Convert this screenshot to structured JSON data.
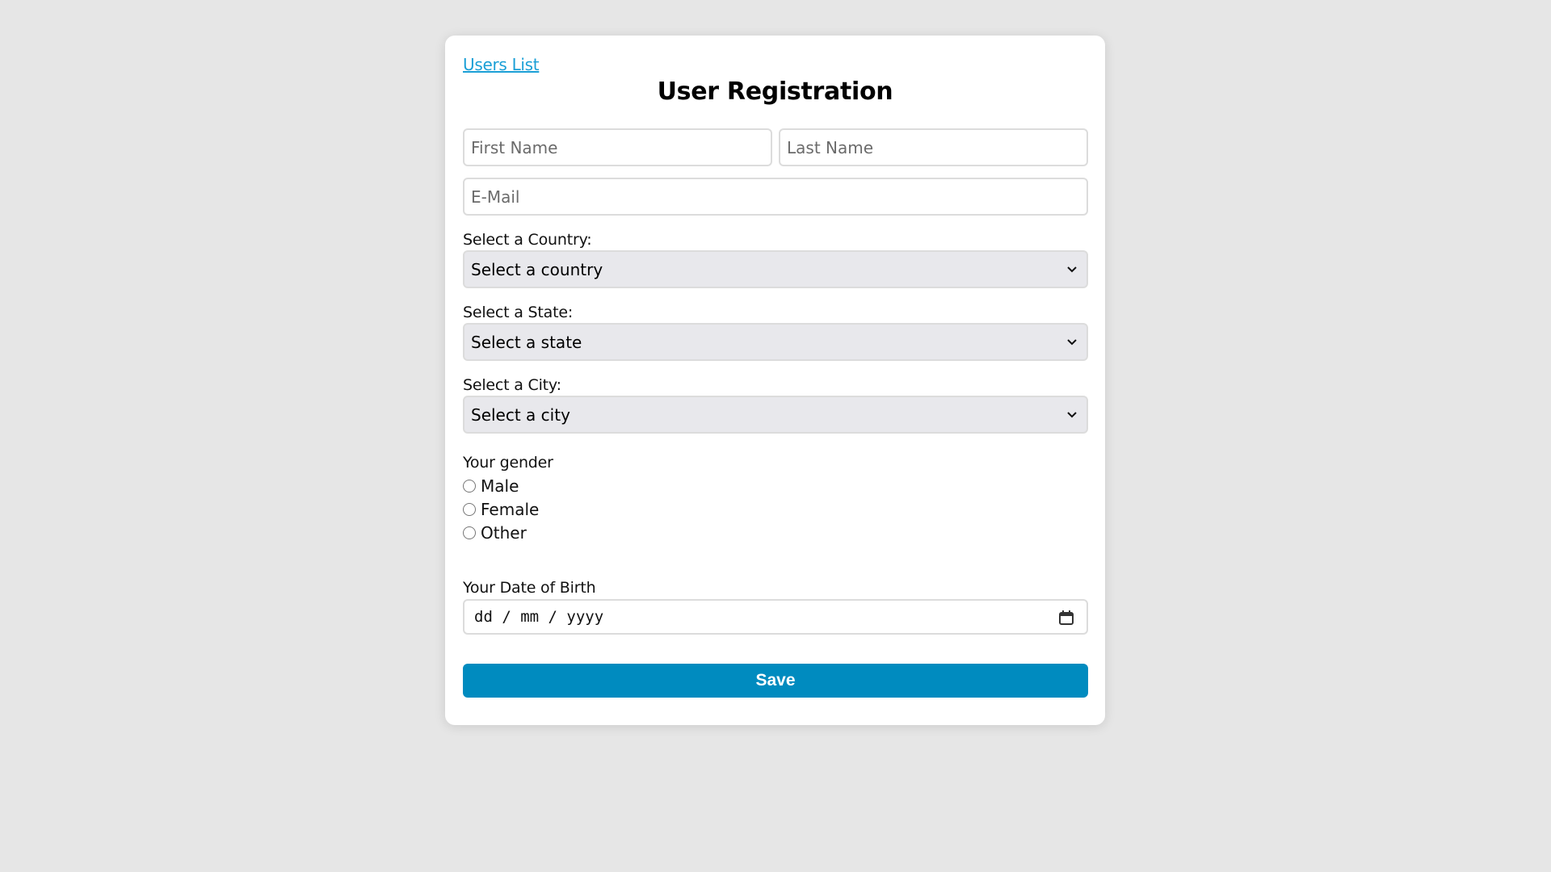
{
  "nav": {
    "users_list_link": "Users List"
  },
  "header": {
    "title": "User Registration"
  },
  "form": {
    "first_name": {
      "placeholder": "First Name",
      "value": ""
    },
    "last_name": {
      "placeholder": "Last Name",
      "value": ""
    },
    "email": {
      "placeholder": "E-Mail",
      "value": ""
    },
    "country": {
      "label": "Select a Country:",
      "selected": "Select a country"
    },
    "state": {
      "label": "Select a State:",
      "selected": "Select a state"
    },
    "city": {
      "label": "Select a City:",
      "selected": "Select a city"
    },
    "gender": {
      "label": "Your gender",
      "options": [
        {
          "label": "Male",
          "checked": false
        },
        {
          "label": "Female",
          "checked": false
        },
        {
          "label": "Other",
          "checked": false
        }
      ]
    },
    "dob": {
      "label": "Your Date of Birth",
      "placeholder": "dd / mm / yyyy",
      "icon": "calendar-icon"
    },
    "save_label": "Save"
  },
  "colors": {
    "accent": "#008bbf",
    "link": "#1a9fd6",
    "background": "#e6e6e6",
    "select_bg": "#e8e8ec"
  }
}
